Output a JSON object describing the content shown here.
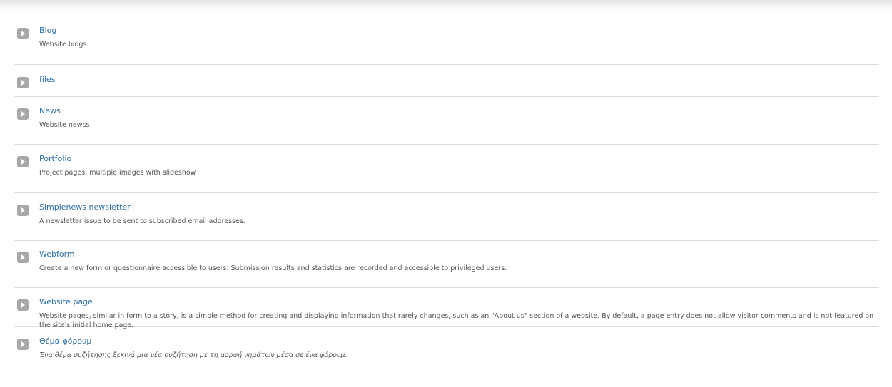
{
  "content_types": [
    {
      "name": "Blog",
      "description": "Website blogs"
    },
    {
      "name": "files",
      "description": ""
    },
    {
      "name": "News",
      "description": "Website newss"
    },
    {
      "name": "Portfolio",
      "description": "Project pages, multiple images with slideshow"
    },
    {
      "name": "Simplenews newsletter",
      "description": "A newsletter issue to be sent to subscribed email addresses."
    },
    {
      "name": "Webform",
      "description": "Create a new form or questionnaire accessible to users. Submission results and statistics are recorded and accessible to privileged users."
    },
    {
      "name": "Website page",
      "description": "Website pages, similar in form to a story, is a simple method for creating and displaying information that rarely changes, such as an \"About us\" section of a website. By default, a page entry does not allow visitor comments and is not featured on the site's initial home page."
    },
    {
      "name": "Θέμα φόρουμ",
      "description": "Ένα θέμα συζήτησης ξεκινά μια νέα συζήτηση με τη μορφή νημάτων μέσα σε ένα φόρουμ."
    }
  ],
  "icons": {
    "item_icon": "arrow-right-icon"
  }
}
